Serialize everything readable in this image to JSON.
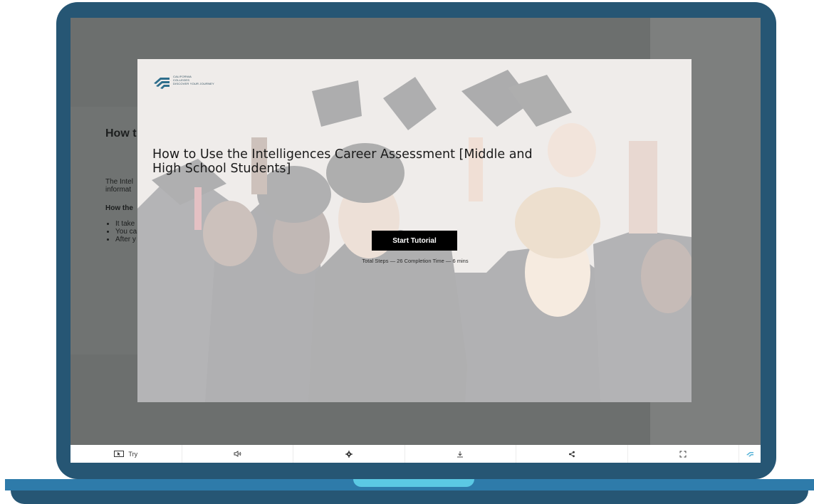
{
  "background_page": {
    "heading": "How t",
    "para_line1": "The Intel",
    "para_line2": "informat",
    "subheading": "How the",
    "bullets": [
      "It take",
      "You ca",
      "After y"
    ]
  },
  "logo": {
    "line1": "CALIFORNIA",
    "line2": "COLLEGES",
    "line3": "DISCOVER YOUR JOURNEY"
  },
  "tutorial": {
    "title": "How to Use the Intelligences Career Assessment [Middle and High School Students]",
    "start_label": "Start Tutorial",
    "meta": "Total Steps — 26    Completion Time — 6 mins"
  },
  "toolbar": {
    "try_label": "Try",
    "icons": [
      "cursor-icon",
      "volume-icon",
      "settings-icon",
      "download-icon",
      "share-icon",
      "fullscreen-icon",
      "brand-icon"
    ]
  },
  "colors": {
    "device_frame": "#265674",
    "device_base": "#2e7baa",
    "device_notch": "#5bc9e4",
    "button": "#000000"
  }
}
